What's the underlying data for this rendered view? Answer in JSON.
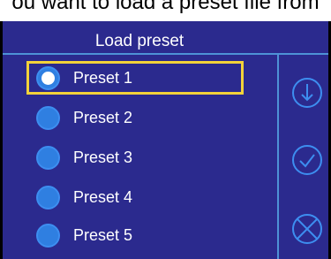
{
  "caption": "ou want to load a preset file from",
  "dialog": {
    "title": "Load preset",
    "presets": [
      {
        "label": "Preset 1",
        "selected": true
      },
      {
        "label": "Preset 2",
        "selected": false
      },
      {
        "label": "Preset 3",
        "selected": false
      },
      {
        "label": "Preset 4",
        "selected": false
      },
      {
        "label": "Preset 5",
        "selected": false
      }
    ],
    "actions": [
      "download-icon",
      "confirm-check-icon",
      "cancel-x-icon"
    ]
  },
  "colors": {
    "panel": "#2b2a8e",
    "accent_line": "#4e92d6",
    "radio": "#2f7fe1",
    "highlight": "#f2d23a",
    "icon": "#3d8ef0"
  }
}
